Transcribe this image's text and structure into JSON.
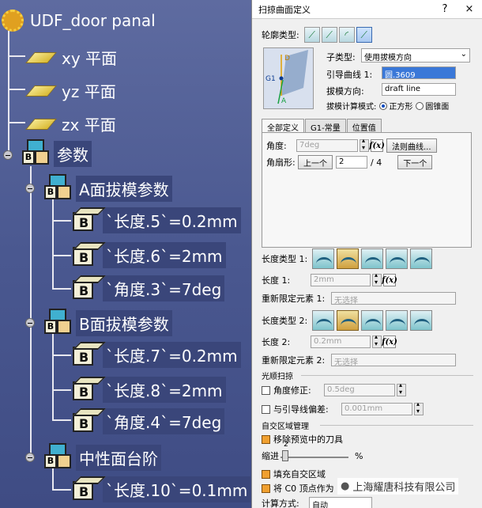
{
  "tree": {
    "root": "UDF_door panal",
    "planes": [
      "xy 平面",
      "yz 平面",
      "zx 平面"
    ],
    "params_group": "参数",
    "groups": [
      {
        "label": "A面拔模参数",
        "items": [
          "`长度.5`=0.2mm",
          "`长度.6`=2mm",
          "`角度.3`=7deg"
        ]
      },
      {
        "label": "B面拔模参数",
        "items": [
          "`长度.7`=0.2mm",
          "`长度.8`=2mm",
          "`角度.4`=7deg"
        ]
      },
      {
        "label": "中性面台阶",
        "items": [
          "`长度.10`=0.1mm"
        ]
      }
    ]
  },
  "dialog": {
    "title": "扫掠曲面定义",
    "help": "?",
    "close": "×",
    "profile_type_label": "轮廓类型:",
    "subtype_label": "子类型:",
    "subtype_value": "使用拔模方向",
    "guide_label": "引导曲线 1:",
    "guide_value": "圆.3609",
    "draft_dir_label": "拔模方向:",
    "draft_dir_value": "draft line",
    "calc_mode_label": "拔模计算模式:",
    "calc_mode_options": [
      "正方形",
      "圆锥面"
    ],
    "preview_labels": {
      "d": "D",
      "g1": "G1",
      "a": "A"
    },
    "tabs": [
      "全部定义",
      "G1-常量",
      "位置值"
    ],
    "angle_label": "角度:",
    "angle_value": "7deg",
    "law_button": "法则曲线...",
    "sector_label": "角扇形:",
    "prev_button": "上一个",
    "sector_value": "2",
    "sector_total": "/ 4",
    "next_button": "下一个",
    "len_type1_label": "长度类型 1:",
    "len1_label": "长度 1:",
    "len1_value": "2mm",
    "relimit1_label": "重新限定元素 1:",
    "relimit1_value": "无选择",
    "len_type2_label": "长度类型 2:",
    "len2_label": "长度 2:",
    "len2_value": "0.2mm",
    "relimit2_label": "重新限定元素 2:",
    "relimit2_value": "无选择",
    "smooth_section": "光顺扫掠",
    "angle_fix_label": "角度修正:",
    "angle_fix_value": "0.5deg",
    "guide_dev_label": "与引导线偏差:",
    "guide_dev_value": "0.001mm",
    "self_intersect_section": "自交区域管理",
    "remove_preview_label": "移除预览中的刀具",
    "step_label": "缩进",
    "step_value": "2",
    "step_unit": "%",
    "fill_label": "填充自交区域",
    "c0_label": "将 C0 顶点作为",
    "bottom_label": "计算方式:",
    "bottom_value": "自动",
    "watermark": "上海耀唐科技有限公司"
  },
  "colors": {
    "tree_bg": "#4a5890",
    "dialog_bg": "#f0f0f0",
    "highlight": "#3a78d8"
  }
}
